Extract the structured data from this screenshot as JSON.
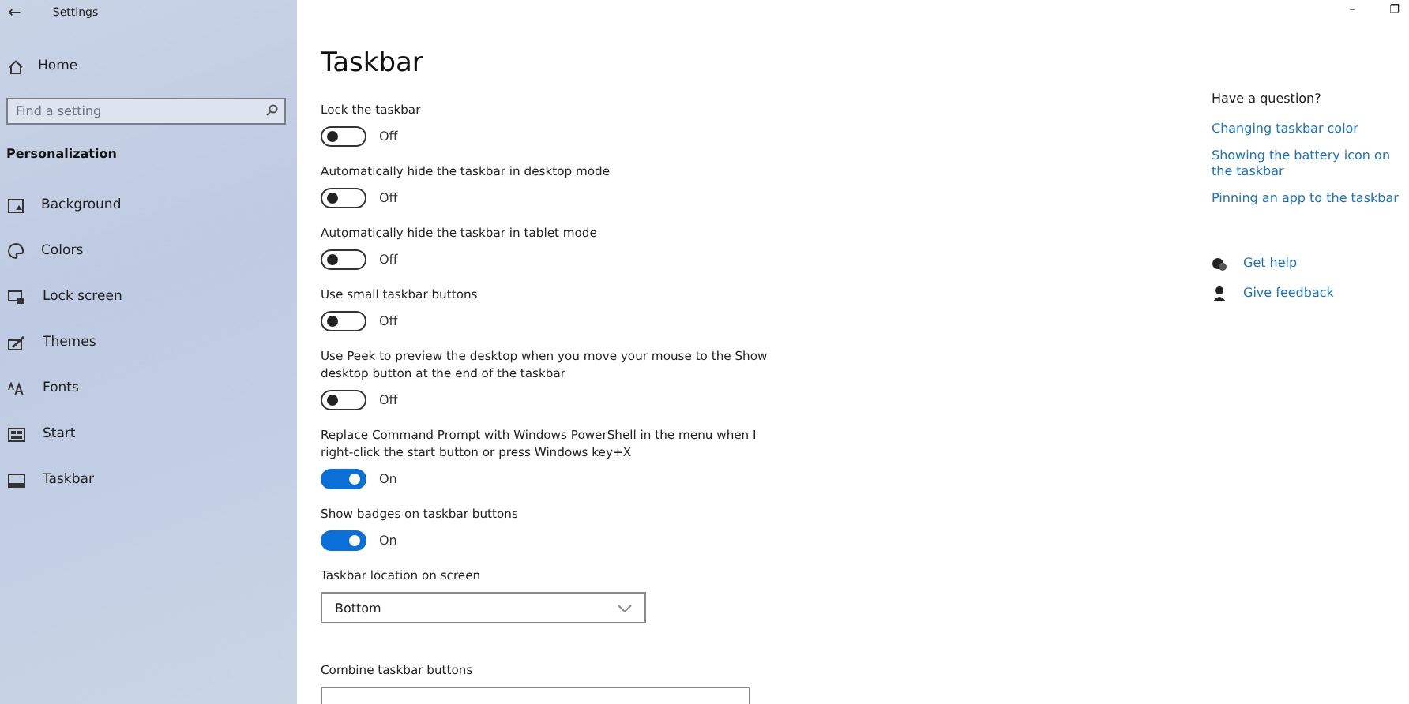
{
  "window": {
    "title": "Settings",
    "back": "←",
    "minimize": "–",
    "restore": "❐"
  },
  "sidebar": {
    "home": "Home",
    "search": {
      "placeholder": "Find a setting"
    },
    "section": "Personalization",
    "items": [
      {
        "label": "Background"
      },
      {
        "label": "Colors"
      },
      {
        "label": "Lock screen"
      },
      {
        "label": "Themes"
      },
      {
        "label": "Fonts"
      },
      {
        "label": "Start"
      },
      {
        "label": "Taskbar"
      }
    ]
  },
  "page": {
    "title": "Taskbar",
    "settings": [
      {
        "kind": "toggle",
        "label": "Lock the taskbar",
        "on": false,
        "state": "Off"
      },
      {
        "kind": "toggle",
        "label": "Automatically hide the taskbar in desktop mode",
        "on": false,
        "state": "Off"
      },
      {
        "kind": "toggle",
        "label": "Automatically hide the taskbar in tablet mode",
        "on": false,
        "state": "Off"
      },
      {
        "kind": "toggle",
        "label": "Use small taskbar buttons",
        "on": false,
        "state": "Off"
      },
      {
        "kind": "toggle",
        "label": "Use Peek to preview the desktop when you move your mouse to the Show desktop button at the end of the taskbar",
        "on": false,
        "state": "Off"
      },
      {
        "kind": "toggle",
        "label": "Replace Command Prompt with Windows PowerShell in the menu when I right-click the start button or press Windows key+X",
        "on": true,
        "state": "On"
      },
      {
        "kind": "toggle",
        "label": "Show badges on taskbar buttons",
        "on": true,
        "state": "On"
      },
      {
        "kind": "dropdown",
        "label": "Taskbar location on screen",
        "value": "Bottom"
      },
      {
        "kind": "dropdown",
        "label": "Combine taskbar buttons"
      }
    ]
  },
  "help": {
    "heading": "Have a question?",
    "links": [
      "Changing taskbar color",
      "Showing the battery icon on the taskbar",
      "Pinning an app to the taskbar"
    ],
    "actions": [
      {
        "kind": "help",
        "label": "Get help"
      },
      {
        "kind": "feedback",
        "label": "Give feedback"
      }
    ]
  }
}
